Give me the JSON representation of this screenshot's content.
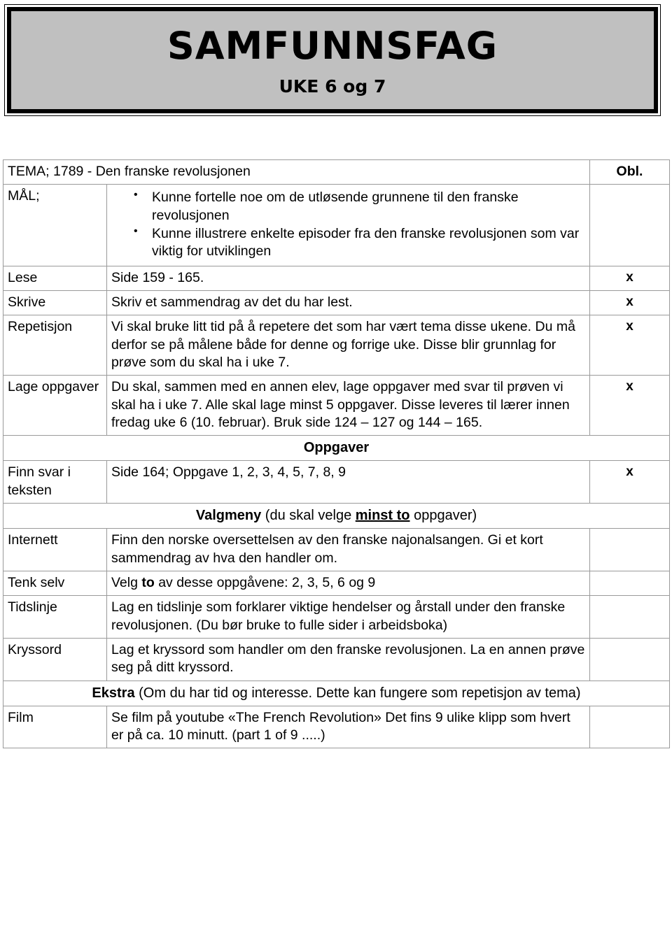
{
  "banner": {
    "title": "SAMFUNNSFAG",
    "subtitle": "UKE 6 og 7"
  },
  "table": {
    "tema_label": "TEMA; 1789 - Den franske revolusjonen",
    "obl_header": "Obl.",
    "check_mark": "x",
    "rows": [
      {
        "label": "MÅL;",
        "goals": [
          "Kunne fortelle noe om de utløsende grunnene til den franske revolusjonen",
          "Kunne illustrere enkelte episoder fra den franske revolusjonen som var viktig for utviklingen"
        ],
        "obl": ""
      },
      {
        "label": "Lese",
        "text": "Side 159 - 165.",
        "obl": "x"
      },
      {
        "label": "Skrive",
        "text": "Skriv et sammendrag av det du har lest.",
        "obl": "x"
      },
      {
        "label": "Repetisjon",
        "text": "Vi skal bruke litt tid på å repetere det som har vært tema disse ukene. Du må derfor se på målene både for denne og forrige uke. Disse blir grunnlag for prøve som du skal ha i uke 7.",
        "obl": "x"
      },
      {
        "label": "Lage oppgaver",
        "text": "Du skal, sammen med en annen elev, lage oppgaver med svar til prøven vi skal ha i uke 7. Alle skal lage minst 5 oppgaver. Disse leveres til lærer innen fredag uke 6 (10. februar). Bruk side 124 – 127 og 144 – 165.",
        "obl": "x"
      }
    ],
    "band_oppgaver": "Oppgaver",
    "row_finn_svar": {
      "label": "Finn svar i teksten",
      "text": "Side 164; Oppgave 1, 2, 3, 4, 5, 7, 8, 9",
      "obl": "x"
    },
    "band_valgmeny": {
      "strong": "Valgmeny",
      "rest_before": " (du skal velge ",
      "underlined": "minst to",
      "rest_after": " oppgaver)"
    },
    "optional_rows": [
      {
        "label": "Internett",
        "text": "Finn den norske oversettelsen av den franske najonalsangen. Gi et kort sammendrag av hva den handler om.",
        "obl": ""
      },
      {
        "label": "Tenk selv",
        "text_before": "Velg ",
        "text_bold": "to",
        "text_after": " av desse oppgåvene: 2, 3, 5, 6 og 9",
        "obl": ""
      },
      {
        "label": "Tidslinje",
        "text": "Lag en tidslinje som forklarer viktige hendelser og årstall under den franske revolusjonen. (Du bør bruke to fulle sider i arbeidsboka)",
        "obl": ""
      },
      {
        "label": "Kryssord",
        "text": "Lag et kryssord som handler om den franske revolusjonen. La en annen prøve seg på ditt kryssord.",
        "obl": ""
      }
    ],
    "band_ekstra": {
      "strong": "Ekstra",
      "rest": " (Om du har tid og interesse. Dette kan fungere som repetisjon av tema)"
    },
    "row_film": {
      "label": "Film",
      "text": "Se film på youtube «The French Revolution» Det fins 9 ulike klipp som hvert er på ca. 10 minutt.  (part 1 of 9 .....)",
      "obl": ""
    }
  },
  "colors": {
    "band_grey": "#c0c0c0",
    "border_grey": "#9a9a9a",
    "text": "#000000"
  }
}
